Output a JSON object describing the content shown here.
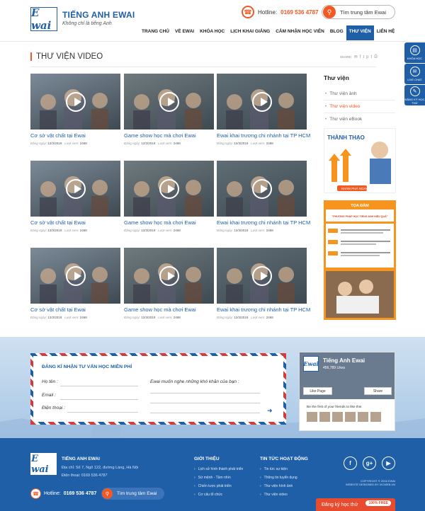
{
  "header": {
    "logo_text": "E wai",
    "brand_name": "TIẾNG ANH EWAI",
    "slogan": "Không chỉ là tiếng Anh",
    "hotline_label": "Hotline:",
    "hotline_number": "0169 536 4787",
    "center_button": "Tìm trung tâm Ewai",
    "nav": [
      {
        "label": "TRANG CHỦ"
      },
      {
        "label": "VỀ EWAI"
      },
      {
        "label": "KHÓA HỌC"
      },
      {
        "label": "LỊCH KHAI GIẢNG"
      },
      {
        "label": "CẢM NHẬN HỌC VIÊN"
      },
      {
        "label": "BLOG"
      },
      {
        "label": "THƯ VIỆN"
      },
      {
        "label": "LIÊN HỆ"
      }
    ],
    "active_nav": "THƯ VIỆN"
  },
  "float_buttons": [
    {
      "label": "KHÓA HỌC",
      "icon": "book-icon"
    },
    {
      "label": "LIVE CHAT",
      "icon": "chat-icon"
    },
    {
      "label": "ĐĂNG KÝ HỌC THỬ",
      "icon": "form-icon"
    }
  ],
  "main": {
    "title": "THƯ VIỆN VIDEO",
    "share_label": "SHARE:",
    "videos": [
      {
        "title": "Cơ sở vật chất tại Ewai",
        "date_label": "Đăng ngày:",
        "date": "12/3/2018",
        "views_label": "Lượt xem:",
        "views": "2468",
        "tone": "#7c8a98"
      },
      {
        "title": "Game show học mà chơi Ewai",
        "date_label": "Đăng ngày:",
        "date": "12/3/2018",
        "views_label": "Lượt xem:",
        "views": "2468",
        "tone": "#6f7a7e"
      },
      {
        "title": "Ewai khai trương chi nhánh tại TP HCM",
        "date_label": "Đăng ngày:",
        "date": "12/3/2018",
        "views_label": "Lượt xem:",
        "views": "2468",
        "tone": "#5f6d75"
      },
      {
        "title": "Cơ sở vật chất tại Ewai",
        "date_label": "Đăng ngày:",
        "date": "12/3/2018",
        "views_label": "Lượt xem:",
        "views": "2468",
        "tone": "#7c8a98"
      },
      {
        "title": "Game show học mà chơi Ewai",
        "date_label": "Đăng ngày:",
        "date": "12/3/2018",
        "views_label": "Lượt xem:",
        "views": "2468",
        "tone": "#6f7a7e"
      },
      {
        "title": "Ewai khai trương chi nhánh tại TP HCM",
        "date_label": "Đăng ngày:",
        "date": "12/3/2018",
        "views_label": "Lượt xem:",
        "views": "2468",
        "tone": "#5f6d75"
      },
      {
        "title": "Cơ sở vật chất tại Ewai",
        "date_label": "Đăng ngày:",
        "date": "12/3/2018",
        "views_label": "Lượt xem:",
        "views": "2468",
        "tone": "#7c8a98"
      },
      {
        "title": "Game show học mà chơi Ewai",
        "date_label": "Đăng ngày:",
        "date": "12/3/2018",
        "views_label": "Lượt xem:",
        "views": "2468",
        "tone": "#6f7a7e"
      },
      {
        "title": "Ewai khai trương chi nhánh tại TP HCM",
        "date_label": "Đăng ngày:",
        "date": "12/3/2018",
        "views_label": "Lượt xem:",
        "views": "2468",
        "tone": "#5f6d75"
      }
    ]
  },
  "sidebar": {
    "title": "Thư viện",
    "items": [
      {
        "label": "Thư viện ảnh"
      },
      {
        "label": "Thư viện video"
      },
      {
        "label": "Thư viện eBook"
      }
    ],
    "active_item": "Thư viện video",
    "banner1_heading": "THÀNH THẠO",
    "banner1_button": "KHÁM PHÁ NGAY",
    "banner2_heading": "TỌA ĐÀM",
    "banner2_sub": "\"PHƯƠNG PHÁP HỌC TIẾNG ANH HIỆU QUẢ\""
  },
  "register": {
    "title": "ĐĂNG KÍ NHẬN TƯ VẤN HỌC MIỄN PHÍ",
    "name_label": "Họ tên :",
    "email_label": "Email :",
    "phone_label": "Điện thoại :",
    "message_label": "Ewai muốn nghe những khó khăn của bạn :"
  },
  "facebook": {
    "page_name": "Tiếng Anh Ewai",
    "likes": "456,789 Likes",
    "like_button": "Like Page",
    "share_button": "Share",
    "friends_text": "Be the first of your friends to like this"
  },
  "footer": {
    "logo_text": "E wai",
    "brand": "TIẾNG ANH EWAI",
    "address": "Địa chỉ: Số 7, Ngõ 122, đường Láng, Hà Nội",
    "phone": "Điện thoại: 0169 536 4787",
    "col1_title": "GIỚI THIỆU",
    "col1_items": [
      {
        "label": "Lịch sử hình thành phát triển"
      },
      {
        "label": "Sứ mệnh - Tầm nhìn"
      },
      {
        "label": "Chiến lược phát triển"
      },
      {
        "label": "Cơ cấu tổ chức"
      }
    ],
    "col2_title": "TIN TỨC HOẠT ĐỘNG",
    "col2_items": [
      {
        "label": "Tin tức sự kiện"
      },
      {
        "label": "Thông tin tuyển dụng"
      },
      {
        "label": "Thư viện hình ảnh"
      },
      {
        "label": "Thư viện video"
      }
    ],
    "copyright_line1": "COPYRIGHT © 2016 EWAI",
    "copyright_line2": "WEBSITE DESIGNED BY VICWEB.VN",
    "hotline_label": "Hotline:",
    "hotline_number": "0169 536 4787",
    "center_button": "Tìm trung tâm Ewai",
    "register_button": "Đăng ký học thử",
    "register_badge": "100% FREE"
  },
  "colors": {
    "brand_blue": "#1f5fa8",
    "accent_orange": "#f15a24"
  }
}
